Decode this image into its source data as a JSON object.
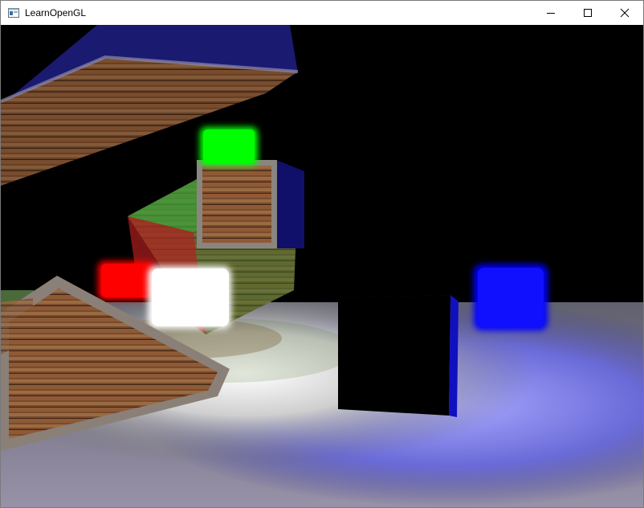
{
  "window": {
    "title": "LearnOpenGL",
    "icon": "opengl-window-icon",
    "buttons": [
      {
        "name": "minimize-button",
        "icon": "minimize-icon"
      },
      {
        "name": "maximize-button",
        "icon": "maximize-icon"
      },
      {
        "name": "close-button",
        "icon": "close-icon"
      }
    ]
  },
  "scene": {
    "description_colors": {
      "background": "#000000",
      "green_light": "#00ff00",
      "red_light": "#ff0000",
      "white_light": "#ffffff",
      "blue_light": "#0000ff",
      "wood": "#8a5a36"
    }
  }
}
